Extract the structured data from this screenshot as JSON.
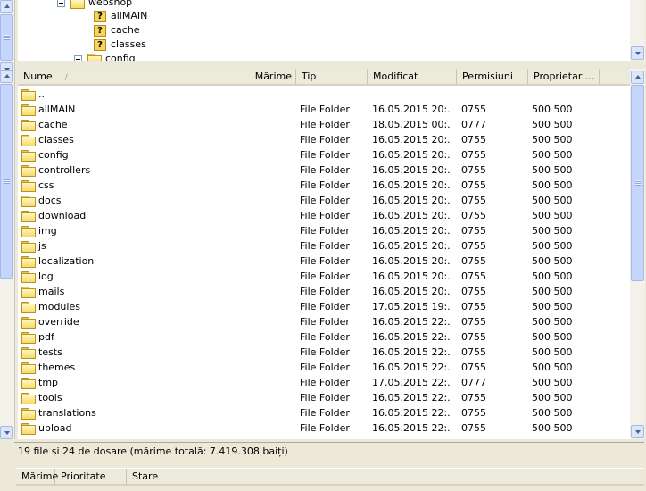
{
  "tree": {
    "items": [
      {
        "label": "webshop",
        "icon": "folder-open-icon",
        "expander": "minus"
      },
      {
        "label": "allMAIN",
        "icon": "question-folder-icon"
      },
      {
        "label": "cache",
        "icon": "question-folder-icon"
      },
      {
        "label": "classes",
        "icon": "question-folder-icon"
      },
      {
        "label": "config",
        "icon": "folder-icon",
        "expander": "minus"
      }
    ]
  },
  "list": {
    "columns": {
      "name": "Nume",
      "size": "Mărime",
      "type": "Tip",
      "modified": "Modificat",
      "permissions": "Permisiuni",
      "owner": "Proprietar ..."
    },
    "parent_label": "..",
    "rows": [
      {
        "name": "allMAIN",
        "type": "File Folder",
        "modified": "16.05.2015 20:...",
        "perm": "0755",
        "owner": "500 500"
      },
      {
        "name": "cache",
        "type": "File Folder",
        "modified": "18.05.2015 00:...",
        "perm": "0777",
        "owner": "500 500"
      },
      {
        "name": "classes",
        "type": "File Folder",
        "modified": "16.05.2015 20:...",
        "perm": "0755",
        "owner": "500 500"
      },
      {
        "name": "config",
        "type": "File Folder",
        "modified": "16.05.2015 20:...",
        "perm": "0755",
        "owner": "500 500"
      },
      {
        "name": "controllers",
        "type": "File Folder",
        "modified": "16.05.2015 20:...",
        "perm": "0755",
        "owner": "500 500"
      },
      {
        "name": "css",
        "type": "File Folder",
        "modified": "16.05.2015 20:...",
        "perm": "0755",
        "owner": "500 500"
      },
      {
        "name": "docs",
        "type": "File Folder",
        "modified": "16.05.2015 20:...",
        "perm": "0755",
        "owner": "500 500"
      },
      {
        "name": "download",
        "type": "File Folder",
        "modified": "16.05.2015 20:...",
        "perm": "0755",
        "owner": "500 500"
      },
      {
        "name": "img",
        "type": "File Folder",
        "modified": "16.05.2015 20:...",
        "perm": "0755",
        "owner": "500 500"
      },
      {
        "name": "js",
        "type": "File Folder",
        "modified": "16.05.2015 20:...",
        "perm": "0755",
        "owner": "500 500"
      },
      {
        "name": "localization",
        "type": "File Folder",
        "modified": "16.05.2015 20:...",
        "perm": "0755",
        "owner": "500 500"
      },
      {
        "name": "log",
        "type": "File Folder",
        "modified": "16.05.2015 20:...",
        "perm": "0755",
        "owner": "500 500"
      },
      {
        "name": "mails",
        "type": "File Folder",
        "modified": "16.05.2015 20:...",
        "perm": "0755",
        "owner": "500 500"
      },
      {
        "name": "modules",
        "type": "File Folder",
        "modified": "17.05.2015 19:...",
        "perm": "0755",
        "owner": "500 500"
      },
      {
        "name": "override",
        "type": "File Folder",
        "modified": "16.05.2015 22:...",
        "perm": "0755",
        "owner": "500 500"
      },
      {
        "name": "pdf",
        "type": "File Folder",
        "modified": "16.05.2015 22:...",
        "perm": "0755",
        "owner": "500 500"
      },
      {
        "name": "tests",
        "type": "File Folder",
        "modified": "16.05.2015 22:...",
        "perm": "0755",
        "owner": "500 500"
      },
      {
        "name": "themes",
        "type": "File Folder",
        "modified": "16.05.2015 22:...",
        "perm": "0755",
        "owner": "500 500"
      },
      {
        "name": "tmp",
        "type": "File Folder",
        "modified": "17.05.2015 22:...",
        "perm": "0777",
        "owner": "500 500"
      },
      {
        "name": "tools",
        "type": "File Folder",
        "modified": "16.05.2015 22:...",
        "perm": "0755",
        "owner": "500 500"
      },
      {
        "name": "translations",
        "type": "File Folder",
        "modified": "16.05.2015 22:...",
        "perm": "0755",
        "owner": "500 500"
      },
      {
        "name": "upload",
        "type": "File Folder",
        "modified": "16.05.2015 22:...",
        "perm": "0755",
        "owner": "500 500"
      }
    ]
  },
  "status": {
    "summary": "19 file și 24 de dosare (mărime totală: 7.419.308 baiți)"
  },
  "queue": {
    "columns": {
      "size": "Mărime",
      "priority": "Prioritate",
      "state": "Stare"
    }
  }
}
